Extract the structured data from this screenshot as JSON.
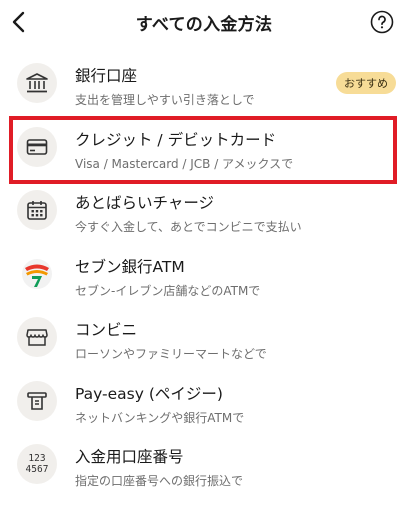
{
  "header": {
    "title": "すべての入金方法"
  },
  "methods": [
    {
      "label": "銀行口座",
      "sub": "支出を管理しやすい引き落としで",
      "badge": "おすすめ"
    },
    {
      "label": "クレジット / デビットカード",
      "sub": "Visa / Mastercard / JCB / アメックスで"
    },
    {
      "label": "あとばらいチャージ",
      "sub": "今すぐ入金して、あとでコンビニで支払い"
    },
    {
      "label": "セブン銀行ATM",
      "sub": "セブン-イレブン店舗などのATMで"
    },
    {
      "label": "コンビニ",
      "sub": "ローソンやファミリーマートなどで"
    },
    {
      "label": "Pay-easy (ペイジー)",
      "sub": "ネットバンキングや銀行ATMで"
    },
    {
      "label": "入金用口座番号",
      "sub": "指定の口座番号への銀行振込で",
      "icon_text": [
        "123",
        "4567"
      ]
    }
  ],
  "colors": {
    "highlight": "#e01c26",
    "badge_bg": "#f7dc97",
    "icon_bg": "#f1efec"
  },
  "icons": [
    "bank-icon",
    "credit-card-icon",
    "calendar-icon",
    "seven-bank-icon",
    "store-icon",
    "atm-receipt-icon",
    "account-number-icon"
  ]
}
